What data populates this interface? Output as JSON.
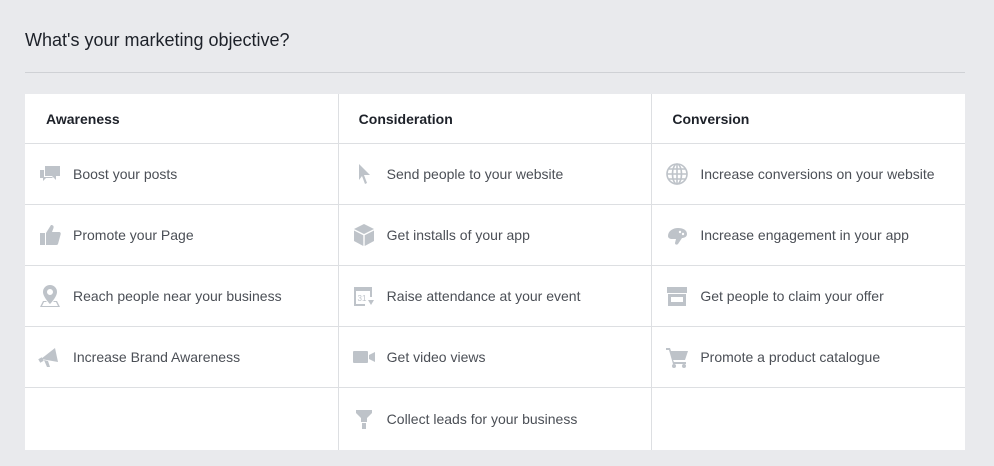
{
  "page": {
    "title": "What's your marketing objective?"
  },
  "colors": {
    "background": "#e9eaed",
    "panel": "#ffffff",
    "icon": "#bec3c9",
    "text": "#4b4f56",
    "heading": "#1d2129"
  },
  "columns": [
    {
      "heading": "Awareness",
      "items": [
        {
          "label": "Boost your posts",
          "icon": "speech-bubbles-icon"
        },
        {
          "label": "Promote your Page",
          "icon": "thumbs-up-icon"
        },
        {
          "label": "Reach people near your business",
          "icon": "map-pin-icon"
        },
        {
          "label": "Increase Brand Awareness",
          "icon": "megaphone-icon"
        }
      ]
    },
    {
      "heading": "Consideration",
      "items": [
        {
          "label": "Send people to your website",
          "icon": "cursor-icon"
        },
        {
          "label": "Get installs of your app",
          "icon": "package-icon"
        },
        {
          "label": "Raise attendance at your event",
          "icon": "calendar-icon",
          "icon_text": "31"
        },
        {
          "label": "Get video views",
          "icon": "video-camera-icon"
        },
        {
          "label": "Collect leads for your business",
          "icon": "funnel-icon"
        }
      ]
    },
    {
      "heading": "Conversion",
      "items": [
        {
          "label": "Increase conversions on your website",
          "icon": "globe-icon"
        },
        {
          "label": "Increase engagement in your app",
          "icon": "game-controller-icon"
        },
        {
          "label": "Get people to claim your offer",
          "icon": "storefront-icon"
        },
        {
          "label": "Promote a product catalogue",
          "icon": "shopping-cart-icon"
        }
      ]
    }
  ]
}
